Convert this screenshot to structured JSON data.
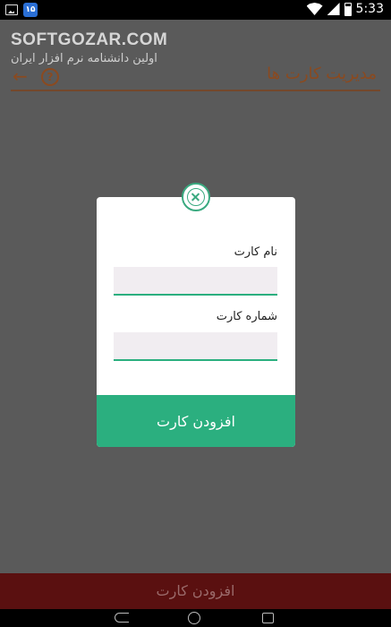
{
  "status_bar": {
    "time": "5:33",
    "app_badge": "۱۵"
  },
  "watermark": {
    "brand": "SOFTGOZAR.COM",
    "subtitle": "اولین دانشنامه نرم افزار ایران"
  },
  "toolbar": {
    "title": "مدیریت کارت ها",
    "back_glyph": "←",
    "help_glyph": "?"
  },
  "dialog": {
    "card_name_label": "نام کارت",
    "card_name_value": "",
    "card_number_label": "شماره کارت",
    "card_number_value": "",
    "submit_label": "افزودن کارت"
  },
  "bottom_bar": {
    "add_label": "افزودن کارت"
  },
  "colors": {
    "accent": "#2baf7f",
    "toolbar_tint": "#8a4a20",
    "bottom_bar": "#5a1010"
  }
}
